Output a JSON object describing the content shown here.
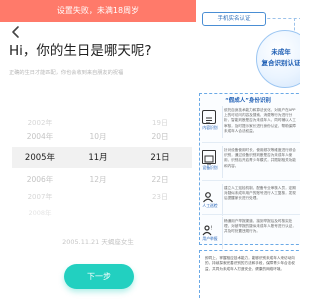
{
  "phone": {
    "toast": "设置失败，未满18周岁",
    "heading": "Hi，你的生日是哪天呢?",
    "subtitle": "正确的生日才能匹配，你也会收到来自朋友的祝福",
    "picker": {
      "years": [
        "2002年",
        "2004年",
        "2005年",
        "2006年",
        "2007年",
        "2008年"
      ],
      "months": [
        "",
        "10月",
        "11月",
        "12月",
        "",
        ""
      ],
      "days": [
        "19日",
        "20日",
        "21日",
        "22日",
        "23日",
        ""
      ],
      "selected": {
        "year": "2005年",
        "month": "11月",
        "day": "21日"
      }
    },
    "summary": "2005.11.21 天蝎座女生",
    "next_label": "下一步",
    "toast_color": "#ff7a6a",
    "button_color": "#22d0c0"
  },
  "infographic": {
    "verify_tag": "手机实名认证",
    "bubble_line1": "未成年",
    "bubble_line2": "复合识别认证",
    "panel_title": "“假成人”身份识别",
    "items": [
      {
        "icon": "doc-icon",
        "label": "内容识别",
        "text": "依托自身技术能力和算法优化，对用户在APP上的可访问内容及搜索、消费等行为进行分析，智能判断是否为未成年人，同时辅以人工审核，及时提示家长进行身份认证，帮助保障未成年人合法权益。"
      },
      {
        "icon": "device-icon",
        "label": "设备识别",
        "text": "针对设备使用时长、使用频次等维度进行综合识别，通过设备识别判断是否为未成年人使用，识别后开启青少年模式，并限制相关功能和内容。"
      },
      {
        "icon": "person-icon",
        "label": "人工巡检",
        "text": "建立人工巡检机制，配备专业审核人员，定期对疑似未成年用户的账号进行人工复核，发现后提醒家长进行处理。"
      },
      {
        "icon": "report-icon",
        "label": "用户举报",
        "text": "畅通用户举报渠道，接到举报后及时核实处理，对被举报的疑似未成年人账号进行认证，并及时处置违规行为。"
      }
    ],
    "bottom_text": "即同上，掌握相应技术能力，能够识别未成年人来访动向的，持续探索完善识别的方法和手段，保障青少年合法权益，共同为未成年人打造安全、健康的网络环境。"
  }
}
